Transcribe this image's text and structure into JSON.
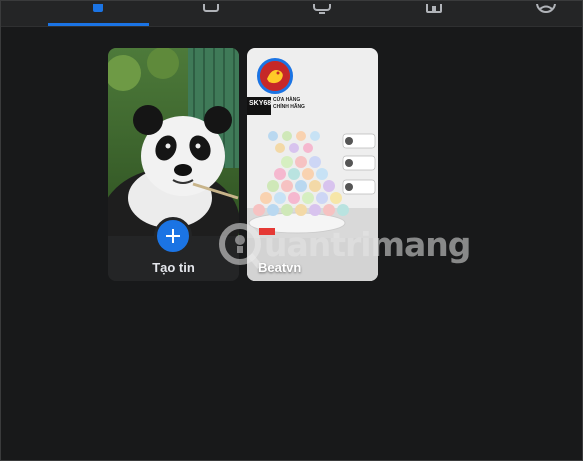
{
  "nav": {
    "tabs": [
      {
        "icon": "home-icon",
        "active": true
      },
      {
        "icon": "video-icon",
        "active": false
      },
      {
        "icon": "gaming-icon",
        "active": false
      },
      {
        "icon": "marketplace-icon",
        "active": false
      },
      {
        "icon": "profile-icon",
        "active": false
      }
    ],
    "accent_color": "#1b74e4"
  },
  "stories": {
    "create_card": {
      "label": "Tạo tin",
      "button_icon": "plus-icon"
    },
    "story_cards": [
      {
        "name": "Beatvn",
        "brand_text": "SKY68",
        "brand_sub_line1": "CỬA HÀNG",
        "brand_sub_line2": "CHÍNH HÃNG"
      }
    ]
  },
  "watermark": {
    "text": "uantrimang",
    "icon": "quantrimang-logo-icon"
  }
}
